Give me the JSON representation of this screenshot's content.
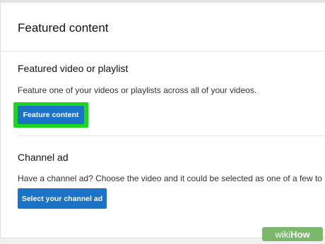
{
  "header": {
    "title": "Featured content"
  },
  "featured": {
    "title": "Featured video or playlist",
    "description": "Feature one of your videos or playlists across all of your videos.",
    "button_label": "Feature content"
  },
  "channel_ad": {
    "title": "Channel ad",
    "description": "Have a channel ad? Choose the video and it could be selected as one of a few to",
    "button_label": "Select your channel ad"
  },
  "watermark": {
    "wiki": "wiki",
    "how": "How"
  },
  "colors": {
    "button": "#1a73c6",
    "highlight": "#19d81b",
    "watermark": "#7bb86b"
  }
}
